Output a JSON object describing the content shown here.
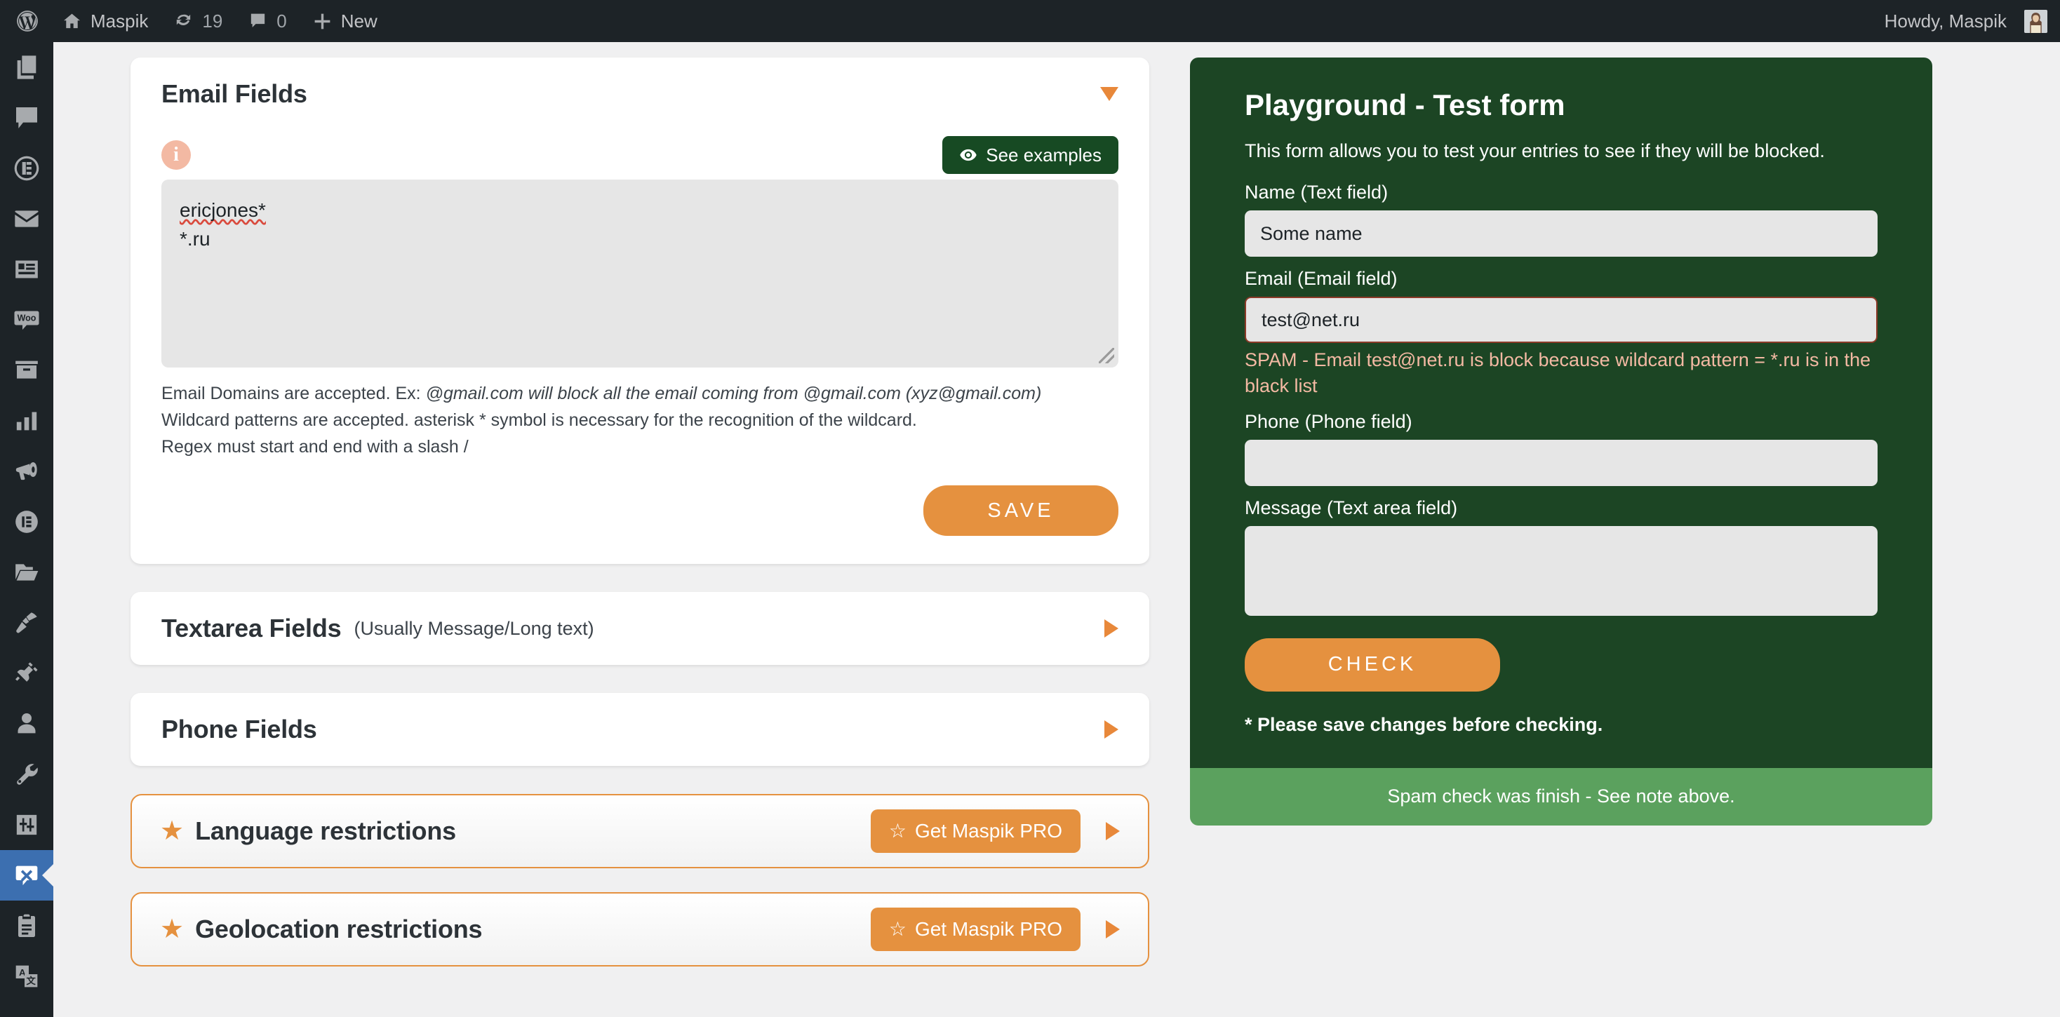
{
  "adminbar": {
    "site_name": "Maspik",
    "updates_count": "19",
    "comments_count": "0",
    "new_label": "New",
    "howdy": "Howdy, Maspik"
  },
  "sidebar": {
    "items": [
      {
        "name": "pages",
        "icon": "pages-icon",
        "current": false
      },
      {
        "name": "comments",
        "icon": "comments-icon",
        "current": false
      },
      {
        "name": "formidable",
        "icon": "formidable-icon",
        "current": false
      },
      {
        "name": "mail",
        "icon": "mail-icon",
        "current": false
      },
      {
        "name": "forms",
        "icon": "form-icon",
        "current": false
      },
      {
        "name": "woocommerce",
        "icon": "woocommerce-icon",
        "current": false
      },
      {
        "name": "products",
        "icon": "archive-box-icon",
        "current": false
      },
      {
        "name": "analytics",
        "icon": "bar-chart-icon",
        "current": false
      },
      {
        "name": "marketing",
        "icon": "megaphone-icon",
        "current": false
      },
      {
        "name": "elementor",
        "icon": "elementor-icon",
        "current": false
      },
      {
        "name": "templates",
        "icon": "folder-icon",
        "current": false
      },
      {
        "name": "appearance",
        "icon": "brush-icon",
        "current": false
      },
      {
        "name": "plugins",
        "icon": "plug-icon",
        "current": false
      },
      {
        "name": "users",
        "icon": "user-icon",
        "current": false
      },
      {
        "name": "tools",
        "icon": "wrench-icon",
        "current": false
      },
      {
        "name": "settings",
        "icon": "sliders-icon",
        "current": false
      },
      {
        "name": "maspik",
        "icon": "spam-block-icon",
        "current": true
      },
      {
        "name": "forms-log",
        "icon": "clipboard-icon",
        "current": false
      },
      {
        "name": "translate",
        "icon": "translate-icon",
        "current": false
      }
    ]
  },
  "email_fields": {
    "title": "Email Fields",
    "see_examples_label": "See examples",
    "info_glyph": "i",
    "blacklist_line1": "ericjones*",
    "blacklist_line2": "*.ru",
    "help": {
      "line1_plain": "Email Domains are accepted. Ex: ",
      "line1_italic": "@gmail.com will block all the email coming from @gmail.com (xyz@gmail.com)",
      "line2": "Wildcard patterns are accepted. asterisk * symbol is necessary for the recognition of the wildcard.",
      "line3": "Regex must start and end with a slash /"
    },
    "save_label": "SAVE"
  },
  "sections": [
    {
      "title": "Textarea Fields",
      "subtitle": "(Usually Message/Long text)"
    },
    {
      "title": "Phone Fields",
      "subtitle": ""
    }
  ],
  "pro_sections": [
    {
      "title": "Language restrictions",
      "button_label": "Get Maspik PRO"
    },
    {
      "title": "Geolocation restrictions",
      "button_label": "Get Maspik PRO"
    }
  ],
  "playground": {
    "title": "Playground - Test form",
    "description": "This form allows you to test your entries to see if they will be blocked.",
    "name_label": "Name (Text field)",
    "name_value": "Some name",
    "email_label": "Email (Email field)",
    "email_value": "test@net.ru",
    "email_error": "SPAM - Email test@net.ru is block because wildcard pattern = *.ru is in the black list",
    "phone_label": "Phone (Phone field)",
    "phone_value": "",
    "message_label": "Message (Text area field)",
    "message_value": "",
    "check_label": "CHECK",
    "note": "* Please save changes before checking.",
    "footer_status": "Spam check was finish - See note above."
  },
  "colors": {
    "accent_orange": "#e5913f",
    "panel_green": "#1c4524",
    "footer_green": "#5ba15e",
    "error_salmon": "#f3b9a3",
    "admin_dark": "#1d2327",
    "current_blue": "#3c6fb0"
  }
}
